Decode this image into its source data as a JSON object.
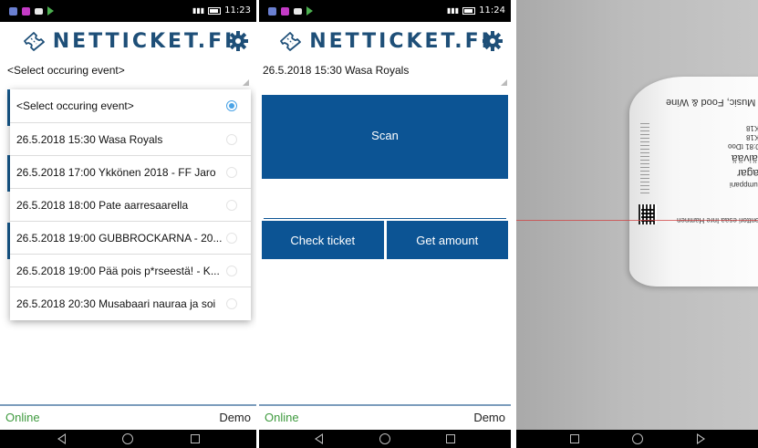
{
  "screens": [
    {
      "status": {
        "time": "11:23"
      },
      "brand": "NETTICKET.FI",
      "select_value": "<Select occuring event>",
      "dropdown_items": [
        {
          "label": "<Select occuring event>",
          "selected": true
        },
        {
          "label": "26.5.2018 15:30 Wasa Royals",
          "selected": false
        },
        {
          "label": "26.5.2018 17:00 Ykkönen 2018 - FF Jaro",
          "selected": false
        },
        {
          "label": "26.5.2018 18:00 Pate aarresaarella",
          "selected": false
        },
        {
          "label": "26.5.2018 19:00 GUBBROCKARNA - 20...",
          "selected": false
        },
        {
          "label": "26.5.2018 19:00 Pää pois p*rseestä! - K...",
          "selected": false
        },
        {
          "label": "26.5.2018 20:30 Musabaari nauraa ja soi",
          "selected": false
        }
      ],
      "footer": {
        "online": "Online",
        "demo": "Demo"
      }
    },
    {
      "status": {
        "time": "11:24"
      },
      "brand": "NETTICKET.FI",
      "select_value": "26.5.2018 15:30 Wasa Royals",
      "scan_label": "Scan",
      "check_label": "Check ticket",
      "amount_label": "Get amount",
      "footer": {
        "online": "Online",
        "demo": "Demo"
      }
    },
    {
      "camera_text": {
        "line1": "Music, Food & Wine",
        "line2": "o K18",
        "line3": "y K18",
        "line4": "00:81 tDoo",
        "line5": "Päivää",
        "line6": "dagar",
        "line7": "Kumppani",
        "line8": "Konttori esaa Inre Hamnen"
      }
    }
  ],
  "colors": {
    "brand_blue": "#0c5494",
    "online_green": "#3e9a3e",
    "radio_blue": "#4aa3e6"
  },
  "icons": [
    "ticket-icon",
    "gear-icon",
    "back-icon",
    "home-icon",
    "recent-apps-icon"
  ]
}
